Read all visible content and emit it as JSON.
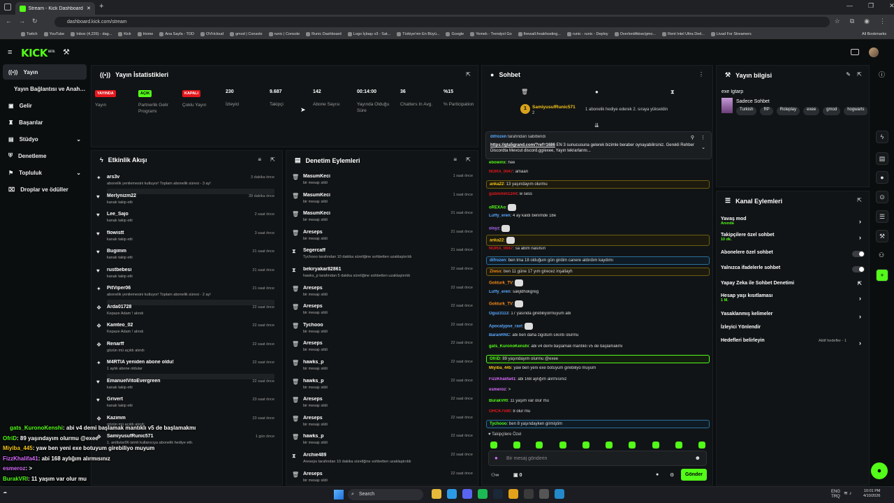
{
  "browser": {
    "tab_title": "Stream - Kick Dashboard",
    "new_tab": "+",
    "url": "dashboard.kick.com/stream",
    "bookmarks": [
      "Twitch",
      "YouTube",
      "Inbox (4,226) - dag...",
      "Kick",
      "Home",
      "Ana Sayfa - TOD",
      "OVHcloud",
      "gmod | Console",
      "runic | Console",
      "Runic Dashboard",
      "Logo İçbaşı v3 - Sat...",
      "Türkiye'nin En Büyü...",
      "Google",
      "Yemek - Trendyol Go",
      "firewall.freakhosting...",
      "runic - runic - Deploy",
      "OverlordAkise/gmo...",
      "Rent Intel Ultra Ded...",
      "Livad For Streamers"
    ],
    "all_bookmarks": "All Bookmarks"
  },
  "header": {
    "logo": "KICK",
    "logo_tag": "BETA"
  },
  "sidebar": {
    "items": [
      {
        "label": "Yayın"
      },
      {
        "label": "Yayın Bağlantısı ve Anahtarı"
      },
      {
        "label": "Gelir"
      },
      {
        "label": "Başarılar"
      },
      {
        "label": "Stüdyo"
      },
      {
        "label": "Denetleme"
      },
      {
        "label": "Topluluk"
      },
      {
        "label": "Droplar ve ödüller"
      }
    ]
  },
  "stats": {
    "title": "Yayın İstatistikleri",
    "cards": [
      {
        "badge": "YAYINDA",
        "badge_color": "#e3171c",
        "label": "Yayın"
      },
      {
        "badge": "AÇIK",
        "badge_color": "#53fc18",
        "label": "Partnerlik Gelir Programı"
      },
      {
        "badge": "KAPALI",
        "badge_color": "#e3171c",
        "label": "Çoklu Yayın"
      },
      {
        "value": "230",
        "label": "İzleyici"
      },
      {
        "value": "9.687",
        "label": "Takipçi"
      },
      {
        "value": "142",
        "label": "Abone Sayısı"
      },
      {
        "value": "00:14:00",
        "label": "Yayında Olduğu Süre"
      },
      {
        "value": "36",
        "label": "Chatters In Avg."
      },
      {
        "value": "%15",
        "label": "% Participation"
      }
    ]
  },
  "activity": {
    "title": "Etkinlik Akışı",
    "items": [
      {
        "name": "ars3v",
        "desc": "abonelik yenilemesini kutluyor! Toplam abonelik süresi - 3 ay!",
        "time": "3 dakika önce",
        "icon": "star-icon"
      },
      {
        "name": "Merlynizm22",
        "desc": "kanalı takip etti",
        "time": "39 dakika önce",
        "icon": "heart-icon"
      },
      {
        "name": "Lee_Sajo",
        "desc": "kanalı takip etti",
        "time": "2 saat önce",
        "icon": "heart-icon"
      },
      {
        "name": "flowistt",
        "desc": "kanalı takip etti",
        "time": "3 saat önce",
        "icon": "heart-icon"
      },
      {
        "name": "Bugimm",
        "desc": "kanalı takip etti",
        "time": "21 saat önce",
        "icon": "heart-icon"
      },
      {
        "name": "rustbebesi",
        "desc": "kanalı takip etti",
        "time": "21 saat önce",
        "icon": "heart-icon"
      },
      {
        "name": "PitViper06",
        "desc": "abonelik yenilemesini kutluyor! Toplam abonelik süresi - 2 ay!",
        "time": "21 saat önce",
        "icon": "star-icon"
      },
      {
        "name": "Arda01728",
        "desc": "Kepaze Adam ! alındı",
        "time": "22 saat önce",
        "icon": "gift-icon"
      },
      {
        "name": "Kamteo_02",
        "desc": "Kepaze Adam ! alındı",
        "time": "22 saat önce",
        "icon": "gift-icon"
      },
      {
        "name": "Renarff",
        "desc": "gözün mü açıldı alındı",
        "time": "22 saat önce",
        "icon": "gift-icon"
      },
      {
        "name": "M4RTIA yeniden abone oldu!",
        "desc": "1 aylık abone oldular",
        "time": "22 saat önce",
        "icon": "star-icon"
      },
      {
        "name": "EmanuelVitoEvergreen",
        "desc": "kanalı takip etti",
        "time": "22 saat önce",
        "icon": "heart-icon"
      },
      {
        "name": "Grivert",
        "desc": "kanalı takip etti",
        "time": "23 saat önce",
        "icon": "heart-icon"
      },
      {
        "name": "Kazimm",
        "desc": "gözün mü açıldı alındı",
        "time": "23 saat önce",
        "icon": "gift-icon"
      },
      {
        "name": "SamiyusufRunic571",
        "desc": "1. aniltutar96 isimli kullanıcıya abonelik hediye etti.",
        "time": "1 gün önce",
        "icon": "gift-icon"
      }
    ]
  },
  "moderation": {
    "title": "Denetim Eylemleri",
    "items": [
      {
        "name": "MasumKeci",
        "desc": "bir mesajı sildi",
        "time": "1 saat önce",
        "icon": "trash-icon"
      },
      {
        "name": "MasumKeci",
        "desc": "bir mesajı sildi",
        "time": "1 saat önce",
        "icon": "trash-icon"
      },
      {
        "name": "MasumKeci",
        "desc": "bir mesajı sildi",
        "time": "21 saat önce",
        "icon": "trash-icon"
      },
      {
        "name": "Areseps",
        "desc": "bir mesajı sildi",
        "time": "21 saat önce",
        "icon": "trash-icon"
      },
      {
        "name": "Segercaff",
        "desc": "Tychooo tarafından 10 dakika süreliğine sohbetten uzaklaştırıldı",
        "time": "21 saat önce",
        "icon": "hourglass-icon"
      },
      {
        "name": "bekiryakar82861",
        "desc": "hawks_p tarafından 5 dakika süreliğine sohbetten uzaklaştırıldı",
        "time": "22 saat önce",
        "icon": "hourglass-icon"
      },
      {
        "name": "Areseps",
        "desc": "bir mesajı sildi",
        "time": "22 saat önce",
        "icon": "trash-icon"
      },
      {
        "name": "Areseps",
        "desc": "bir mesajı sildi",
        "time": "22 saat önce",
        "icon": "trash-icon"
      },
      {
        "name": "Tychooo",
        "desc": "bir mesajı sildi",
        "time": "22 saat önce",
        "icon": "trash-icon"
      },
      {
        "name": "Areseps",
        "desc": "bir mesajı sildi",
        "time": "22 saat önce",
        "icon": "trash-icon"
      },
      {
        "name": "hawks_p",
        "desc": "bir mesajı sildi",
        "time": "22 saat önce",
        "icon": "trash-icon"
      },
      {
        "name": "hawks_p",
        "desc": "bir mesajı sildi",
        "time": "22 saat önce",
        "icon": "trash-icon"
      },
      {
        "name": "Areseps",
        "desc": "bir mesajı sildi",
        "time": "22 saat önce",
        "icon": "trash-icon"
      },
      {
        "name": "Areseps",
        "desc": "bir mesajı sildi",
        "time": "22 saat önce",
        "icon": "trash-icon"
      },
      {
        "name": "hawks_p",
        "desc": "bir mesajı sildi",
        "time": "22 saat önce",
        "icon": "trash-icon"
      },
      {
        "name": "Archie489",
        "desc": "Areseps tarafından 10 dakika süreliğine sohbetten uzaklaştırıldı",
        "time": "22 saat önce",
        "icon": "hourglass-icon"
      },
      {
        "name": "Areseps",
        "desc": "bir mesajı sildi",
        "time": "22 saat önce",
        "icon": "trash-icon"
      }
    ]
  },
  "chat": {
    "title": "Sohbet",
    "gift_user": "SamiyusufRunic571",
    "gift_count": "2",
    "gift_text": "1 abonelik hediye ederek 2. sıraya yükseldin",
    "pinned_by": "difrozen",
    "pinned_label": "tarafından sabitlendi",
    "pinned_link": "https://gta5grand.com/?ref=1686",
    "pinned_text": "EN 3 sunucusuna gelerek bizimle beraber oynayabilirsiniz. Gerekli Rehber Discordta Mevcut discord.gg/exee, Yayın tekrarlarını...",
    "messages": [
      {
        "user": "ebowinx",
        "color": "#53fc18",
        "text": "hee"
      },
      {
        "user": "NORA_0047",
        "color": "#e3171c",
        "text": "amaan"
      },
      {
        "user": "anka22",
        "color": "#f5c518",
        "text": "13 yaşındayım olurmu"
      },
      {
        "user": "gubmmm1244",
        "color": "#e3171c",
        "text": "w sess"
      },
      {
        "user": "oREXAo",
        "color": "#53fc18",
        "text": ""
      },
      {
        "user": "Luffy_eren",
        "color": "#5aa9ff",
        "text": "4 ay kaldı benimde 18e"
      },
      {
        "user": "oisyz",
        "color": "#b06bff",
        "text": ""
      },
      {
        "user": "anka22",
        "color": "#f5c518",
        "text": ""
      },
      {
        "user": "NORA_0047",
        "color": "#e3171c",
        "text": "sa abim nasılsın"
      },
      {
        "user": "difrozen",
        "color": "#5aa9ff",
        "text": "ben tma 18 olduğum gün girdim canere aldırdım kaydımı"
      },
      {
        "user": "Ziwsx",
        "color": "#f58a18",
        "text": "ben 11 güne 17 yım girecez inşallayh"
      },
      {
        "user": "Gokturk_TV",
        "color": "#f58a18",
        "text": ""
      },
      {
        "user": "Luffy_eren",
        "color": "#5aa9ff",
        "text": "sakjldhokgreg"
      },
      {
        "user": "Gokturk_TV",
        "color": "#f58a18",
        "text": ""
      },
      {
        "user": "Oguz3113",
        "color": "#5aa9ff",
        "text": "17 yasında girebiliyormuyum abi"
      },
      {
        "user": "Apocalypse_ravi",
        "color": "#5aa9ff",
        "text": ""
      },
      {
        "user": "BaranRNC",
        "color": "#5aa9ff",
        "text": "abi ben daha zigotum sıkıntı olurmu"
      },
      {
        "user": "gats_KuronoKenshi",
        "color": "#53fc18",
        "text": "abi v4 demi başlamak mantıklı v5 de başlamakmı"
      },
      {
        "user": "OfriD",
        "color": "#53fc18",
        "text": "89 yaşındayım olurmu @exee"
      },
      {
        "user": "Miyiba_445",
        "color": "#f5c518",
        "text": "yaw ben yeni exe botuyum girebiliyo muyum"
      },
      {
        "user": "FizzKhalifa41",
        "color": "#d96bff",
        "text": "abi 168 aylığım alırmısınız"
      },
      {
        "user": "esmeroz",
        "color": "#d96bff",
        "text": ">"
      },
      {
        "user": "BurakVRI",
        "color": "#53fc18",
        "text": "11 yaşım var olur mu"
      },
      {
        "user": "OHCK7590",
        "color": "#e3171c",
        "text": "8 olur mu"
      },
      {
        "user": "Tychooo",
        "color": "#53fc18",
        "text": "ben 8 yaşındayken girmiştim"
      }
    ],
    "followers_only": "Takipçilere Özel",
    "input_placeholder": "Bir mesaj gönderin",
    "points": "0",
    "send_label": "Gönder"
  },
  "stream_info": {
    "title": "Yayın bilgisi",
    "stream_title": "exe Igtarp",
    "category": "Sadece Sohbet",
    "tags": [
      "Turkish",
      "RP",
      "Roleplay",
      "exee",
      "gmod",
      "hogwarts"
    ]
  },
  "channel_actions": {
    "title": "Kanal Eylemleri",
    "items": [
      {
        "label": "Yavaş mod",
        "sub": "Anında",
        "control": "chevron"
      },
      {
        "label": "Takipçilere özel sohbet",
        "sub": "10 dk.",
        "control": "chevron"
      },
      {
        "label": "Abonelere özel sohbet",
        "sub": "",
        "control": "toggle"
      },
      {
        "label": "Yalnızca ifadelerle sohbet",
        "sub": "",
        "control": "toggle"
      },
      {
        "label": "Yapay Zeka ile Sohbet Denetimi",
        "sub": "",
        "control": "external"
      },
      {
        "label": "Hesap yaşı kısıtlaması",
        "sub": "1 M.",
        "control": "chevron"
      },
      {
        "label": "Yasaklanmış kelimeler",
        "sub": "",
        "control": "chevron"
      },
      {
        "label": "İzleyici Yönlendir",
        "sub": "",
        "control": "none"
      },
      {
        "label": "Hedefleri belirleyin",
        "sub": "",
        "control": "chevron",
        "badge": "Aktif hedefler - 1"
      }
    ]
  },
  "overlay_chat": [
    {
      "user": "gats_KuronoKenshi",
      "color": "#53fc18",
      "text": ": abi v4 demi başlamak mantıklı v5 de başlamakmı"
    },
    {
      "user": "OfriD",
      "color": "#53fc18",
      "text": ": 89 yaşındayım olurmu @exee"
    },
    {
      "user": "Miyiba_445",
      "color": "#f5c518",
      "text": ": yaw ben yeni exe botuyum girebiliyo muyum"
    },
    {
      "user": "FizzKhalifa41",
      "color": "#d96bff",
      "text": ": abi 168 aylığım alırmısınız"
    },
    {
      "user": "esmeroz",
      "color": "#d96bff",
      "text": ": >"
    },
    {
      "user": "BurakVRI",
      "color": "#53fc18",
      "text": ": 11 yaşım var olur mu"
    },
    {
      "user": "OHCK7590",
      "color": "#e3171c",
      "text": ": 8 olur mu"
    },
    {
      "user": "Tychooo",
      "color": "#53fc18",
      "text": ": ben 8 yaşındayken girmiştim"
    }
  ],
  "taskbar": {
    "search": "Search",
    "lang": "ENG",
    "region": "TRQ",
    "time": "10:01 PM",
    "date": "4/10/2026"
  },
  "colors": {
    "accent": "#53fc18",
    "live": "#e3171c"
  }
}
